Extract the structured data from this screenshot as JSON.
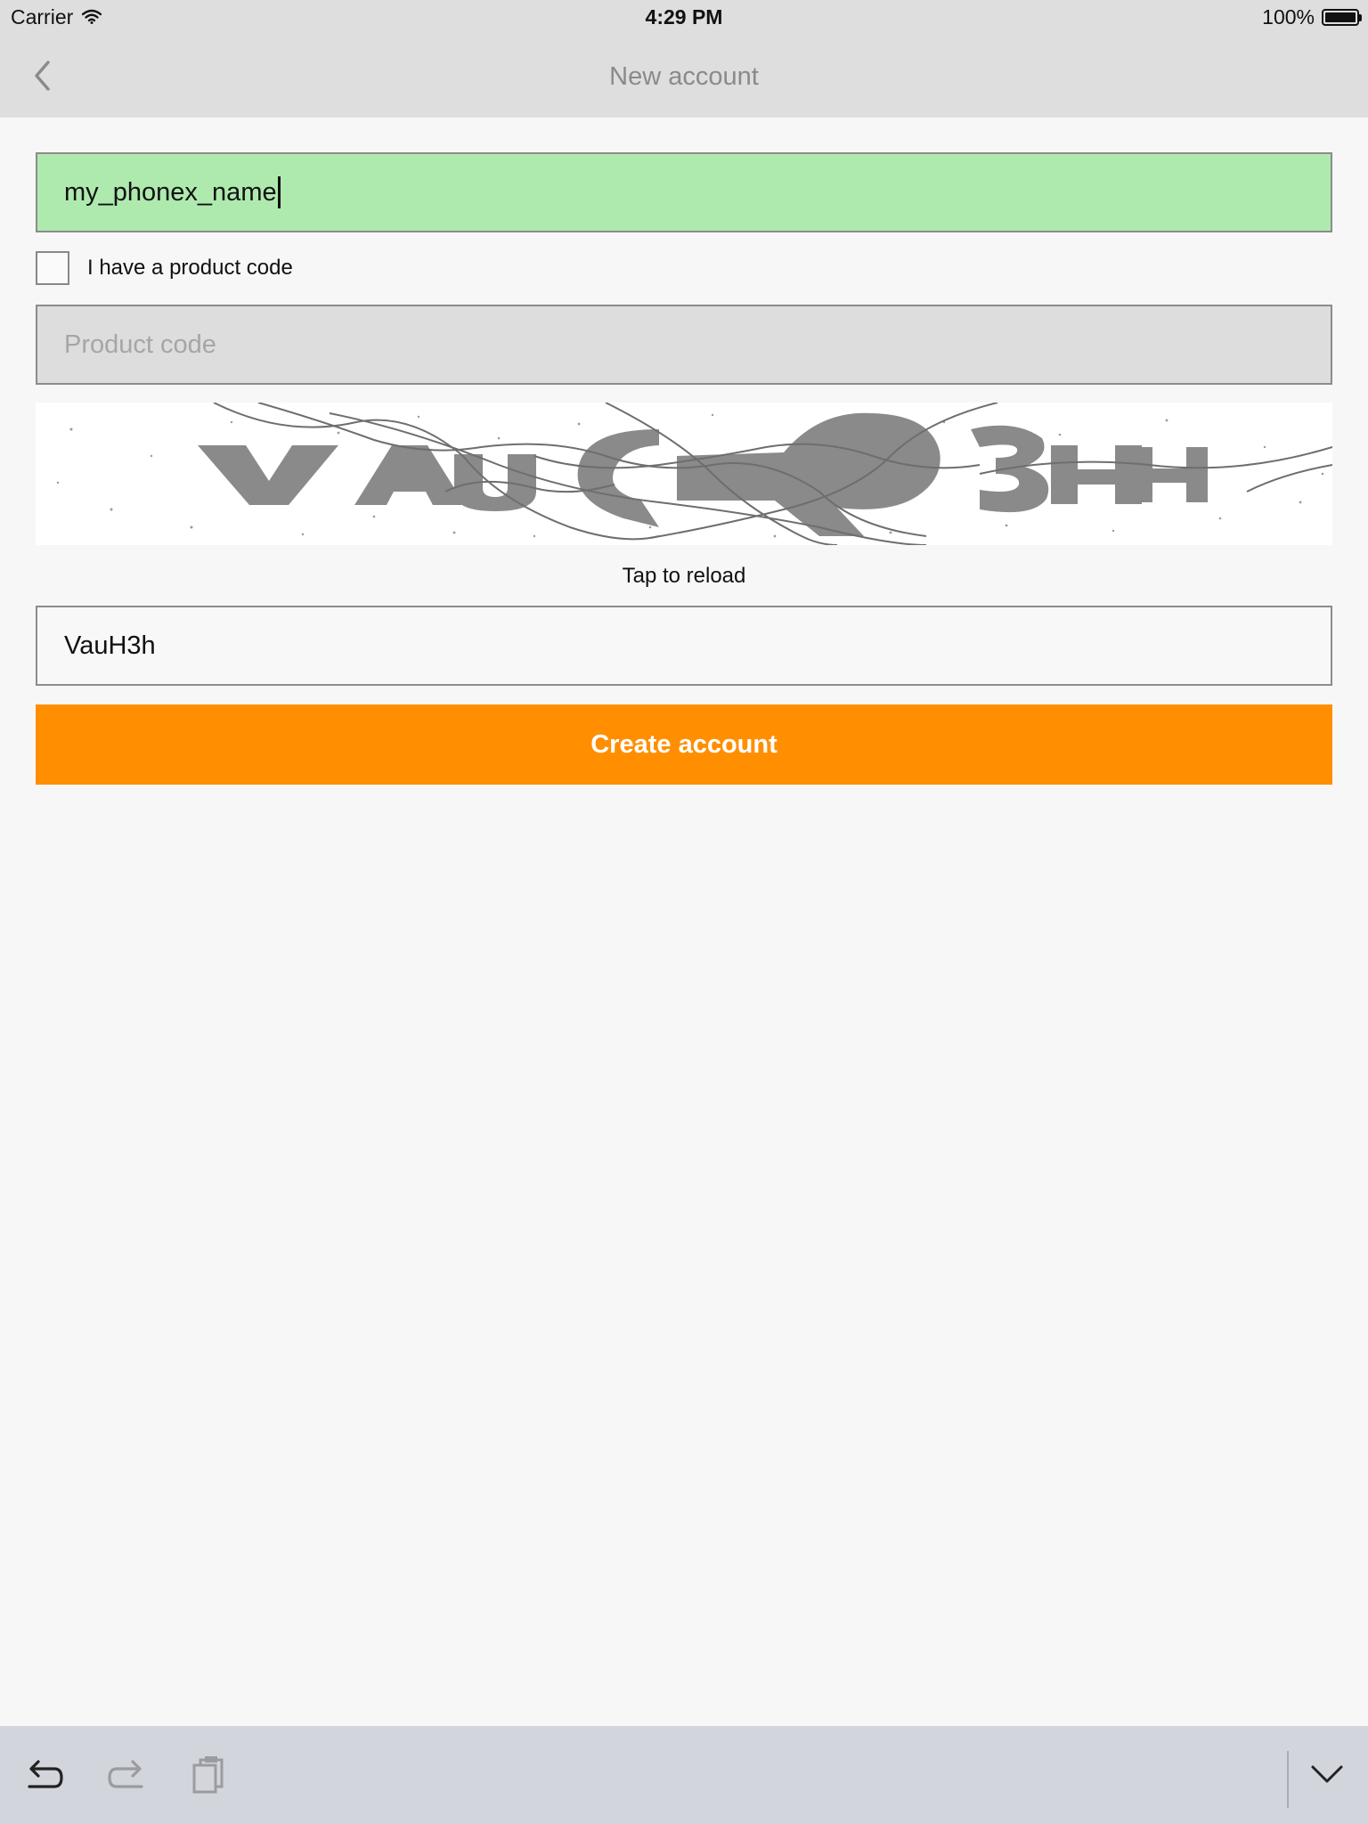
{
  "status_bar": {
    "carrier": "Carrier",
    "time": "4:29 PM",
    "battery_percent": "100%",
    "battery_level": 1.0
  },
  "nav": {
    "title": "New account",
    "back_icon": "chevron-left-icon"
  },
  "form": {
    "username_value": "my_phonex_name",
    "product_code_checkbox_label": "I have a product code",
    "product_code_checked": false,
    "product_code_placeholder": "Product code",
    "captcha_reload_text": "Tap to reload",
    "captcha_value": "VauH3h",
    "create_button_label": "Create account"
  },
  "accessory_bar": {
    "undo_icon": "undo-icon",
    "redo_icon": "redo-icon",
    "paste_icon": "clipboard-icon",
    "dismiss_icon": "chevron-down-icon"
  },
  "colors": {
    "accent": "#ff8f00",
    "valid_field": "#aeeaae",
    "disabled_field": "#dddddd",
    "bar_background": "#dedede"
  }
}
